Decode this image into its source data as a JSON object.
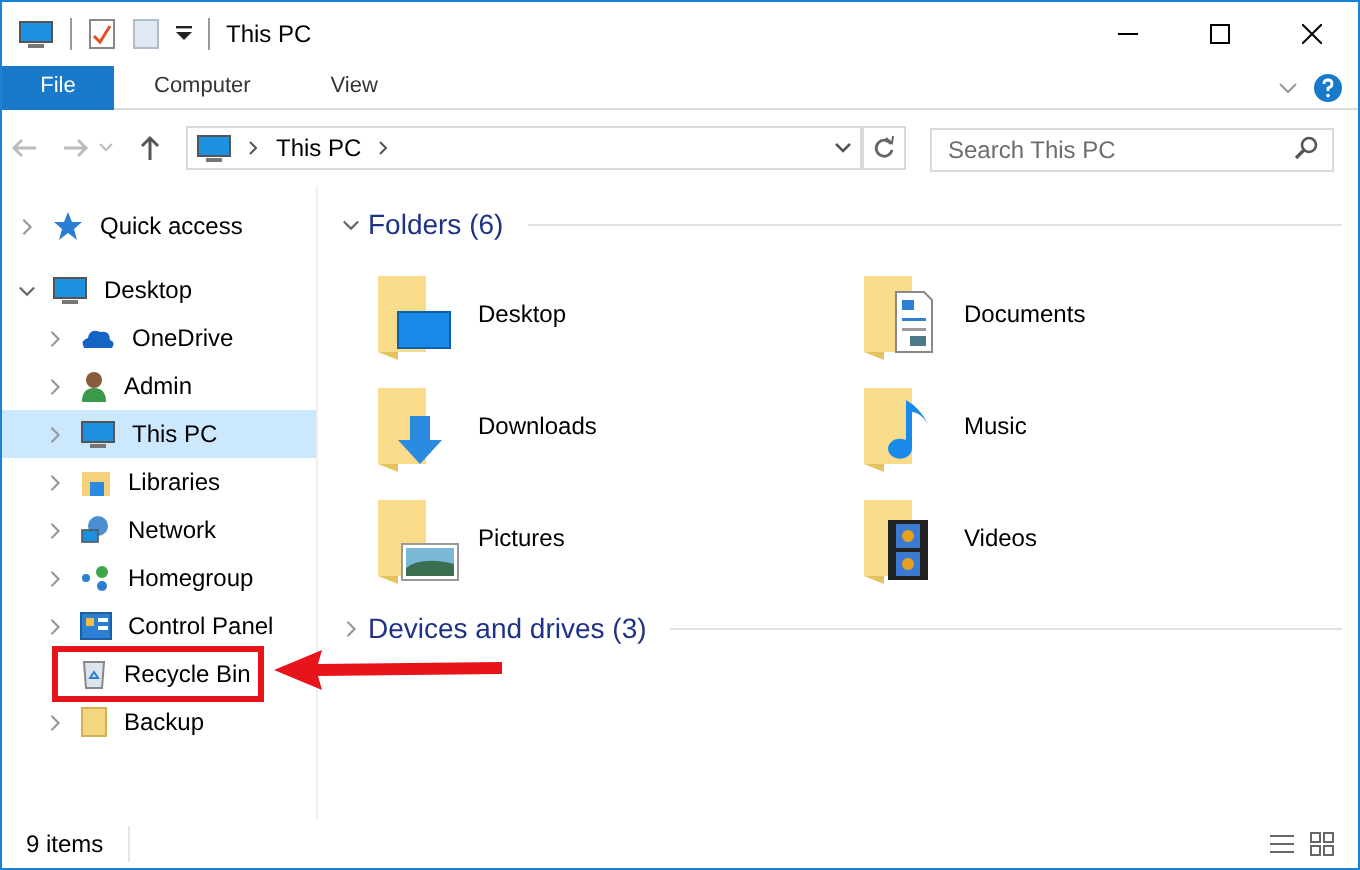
{
  "window": {
    "title": "This PC"
  },
  "ribbon_tabs": [
    {
      "label": "File",
      "selected": true
    },
    {
      "label": "Computer",
      "selected": false
    },
    {
      "label": "View",
      "selected": false
    }
  ],
  "address": {
    "path": [
      "This PC"
    ]
  },
  "search": {
    "placeholder": "Search This PC"
  },
  "sidebar": {
    "items": [
      {
        "label": "Quick access",
        "kind": "node",
        "expanded": false,
        "selected": false,
        "highlighted": false
      },
      {
        "label": "Desktop",
        "kind": "node",
        "expanded": true,
        "selected": false,
        "highlighted": false,
        "children": [
          {
            "label": "OneDrive",
            "kind": "node",
            "selected": false,
            "highlighted": false
          },
          {
            "label": "Admin",
            "kind": "node",
            "selected": false,
            "highlighted": false
          },
          {
            "label": "This PC",
            "kind": "node",
            "selected": true,
            "highlighted": false
          },
          {
            "label": "Libraries",
            "kind": "node",
            "selected": false,
            "highlighted": false
          },
          {
            "label": "Network",
            "kind": "node",
            "selected": false,
            "highlighted": false
          },
          {
            "label": "Homegroup",
            "kind": "node",
            "selected": false,
            "highlighted": false
          },
          {
            "label": "Control Panel",
            "kind": "node",
            "selected": false,
            "highlighted": false
          },
          {
            "label": "Recycle Bin",
            "kind": "leaf",
            "selected": false,
            "highlighted": true
          },
          {
            "label": "Backup",
            "kind": "node",
            "selected": false,
            "highlighted": false
          }
        ]
      }
    ]
  },
  "groups": [
    {
      "title": "Folders (6)",
      "expanded": true,
      "items": [
        "Desktop",
        "Documents",
        "Downloads",
        "Music",
        "Pictures",
        "Videos"
      ]
    },
    {
      "title": "Devices and drives (3)",
      "expanded": false
    }
  ],
  "status_bar": {
    "count": "9 items"
  }
}
